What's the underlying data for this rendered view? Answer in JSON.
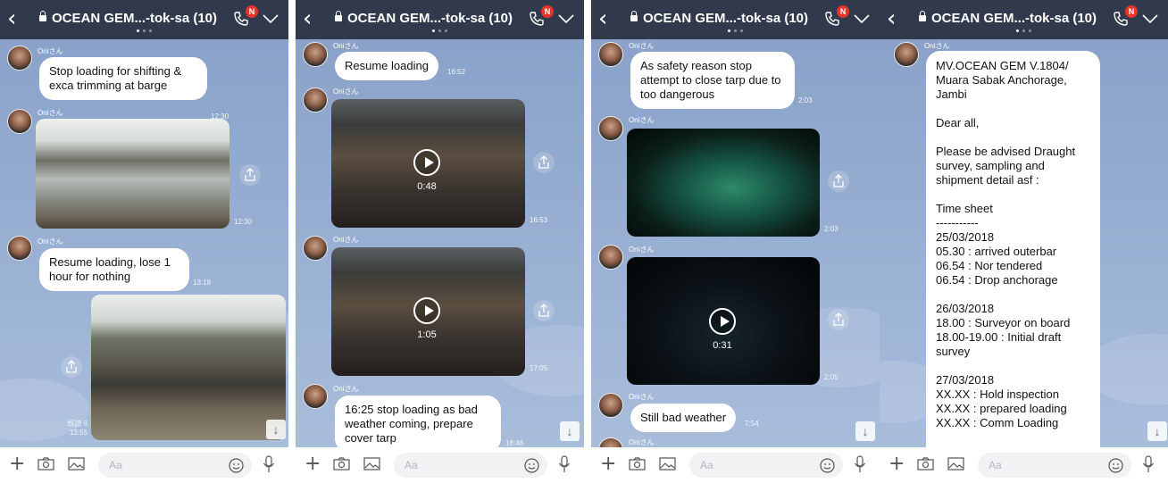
{
  "colors": {
    "header": "#313a4c",
    "chat_bg": "#9ab1d4",
    "badge": "#e8332a"
  },
  "header": {
    "title": "OCEAN GEM...-tok-sa (10)",
    "badge": "N"
  },
  "footer": {
    "placeholder": "Aa"
  },
  "sender": "Oniさん",
  "panels": [
    {
      "m1": {
        "text": "Stop loading for shifting & exca trimming at barge",
        "time": "12:30"
      },
      "m2": {
        "time": "12:30"
      },
      "m3": {
        "text": "Resume loading, lose 1 hour for nothing",
        "time": "13:18"
      },
      "m4": {
        "read": "既読 8",
        "time": "13:55"
      }
    },
    {
      "m1": {
        "text": "Resume loading",
        "time": "16:52"
      },
      "m2": {
        "duration": "0:48",
        "time": "16:53"
      },
      "m3": {
        "duration": "1:05",
        "time": "17:05"
      },
      "m4": {
        "text": "16:25 stop loading as bad weather coming, prepare cover tarp",
        "time": "18:46"
      }
    },
    {
      "m1": {
        "text": "As safety reason stop attempt to close tarp due to too dangerous",
        "time": "2:03"
      },
      "m2": {
        "time": "2:03"
      },
      "m3": {
        "duration": "0:31",
        "time": "2:05"
      },
      "m4": {
        "text": "Still bad weather",
        "time": "7:54"
      }
    },
    {
      "m1": {
        "lines": [
          "MV.OCEAN GEM V.1804/",
          "Muara Sabak Anchorage,",
          "Jambi",
          "",
          "Dear all,",
          "",
          "Please be advised Draught",
          "survey, sampling and",
          "shipment detail asf :",
          "",
          "Time sheet",
          "-----------",
          "25/03/2018",
          "05.30 : arrived outerbar",
          "06.54 : Nor tendered",
          "06.54 : Drop anchorage",
          "",
          "26/03/2018",
          "18.00 : Surveyor on board",
          "18.00-19.00 : Initial draft",
          "survey",
          "",
          "27/03/2018",
          "XX.XX : Hold inspection",
          "XX.XX : prepared loading",
          "XX.XX : Comm Loading"
        ]
      }
    }
  ]
}
